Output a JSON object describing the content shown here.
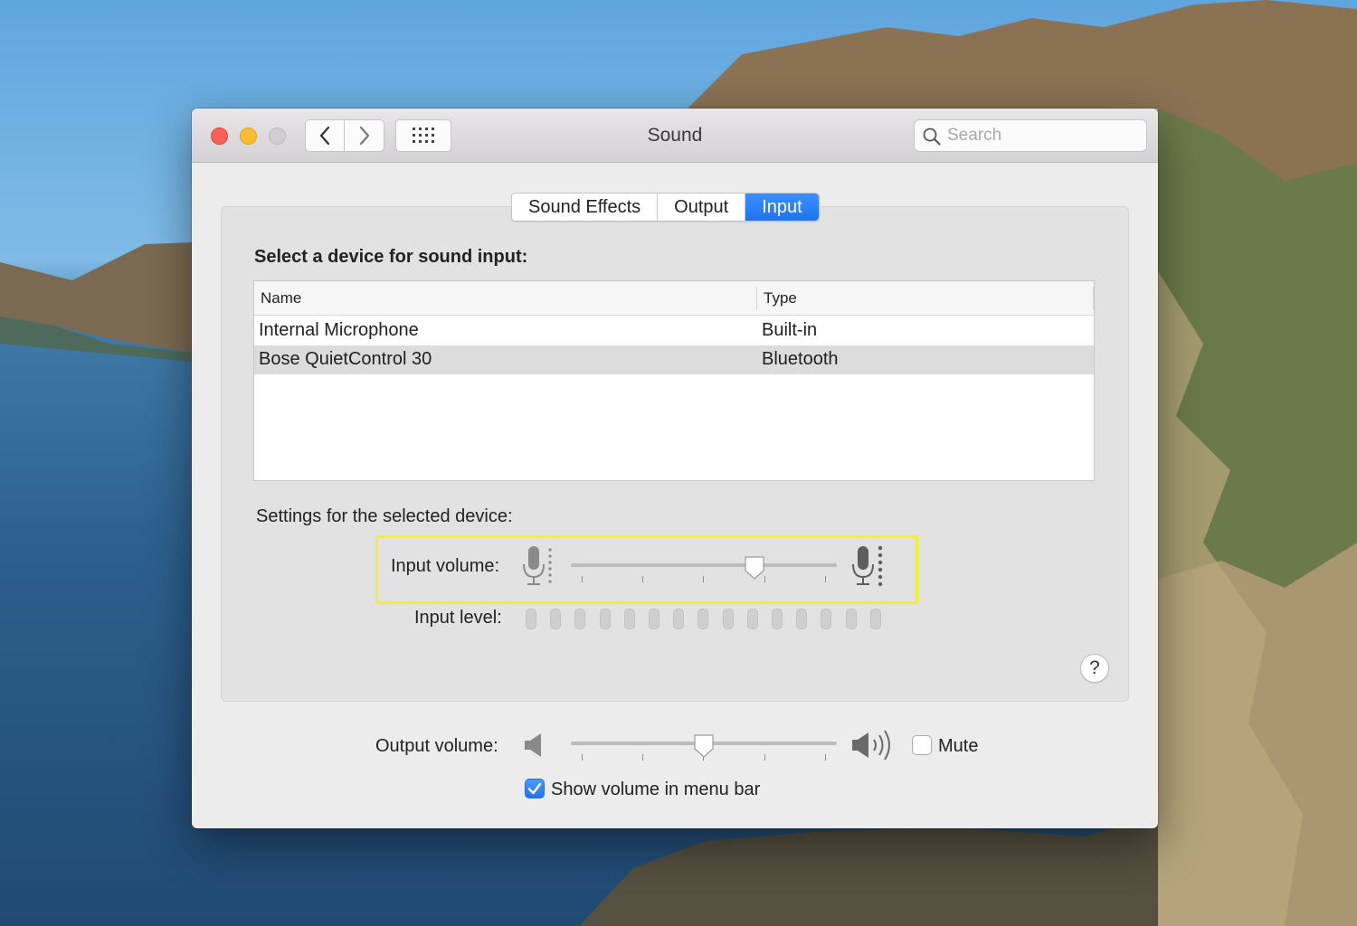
{
  "window": {
    "title": "Sound",
    "search_placeholder": "Search"
  },
  "tabs": [
    {
      "label": "Sound Effects",
      "active": false
    },
    {
      "label": "Output",
      "active": false
    },
    {
      "label": "Input",
      "active": true
    }
  ],
  "input": {
    "heading": "Select a device for sound input:",
    "columns": [
      "Name",
      "Type"
    ],
    "devices": [
      {
        "name": "Internal Microphone",
        "type": "Built-in",
        "selected": false
      },
      {
        "name": "Bose QuietControl 30",
        "type": "Bluetooth",
        "selected": true
      }
    ],
    "settings_label": "Settings for the selected device:",
    "input_volume_label": "Input volume:",
    "input_volume_fraction": 0.69,
    "input_level_label": "Input level:",
    "input_level_segments": 15,
    "input_level_lit": 0
  },
  "help_label": "?",
  "output": {
    "volume_label": "Output volume:",
    "volume_fraction": 0.5,
    "mute_label": "Mute",
    "mute_checked": false,
    "show_in_menu_label": "Show volume in menu bar",
    "show_in_menu_checked": true
  },
  "colors": {
    "accent": "#1f73f1",
    "highlight": "#f3ee36",
    "close": "#fe5f57",
    "minimize": "#febc2e"
  },
  "icons": [
    "close-icon",
    "minimize-icon",
    "zoom-icon",
    "chevron-left-icon",
    "chevron-right-icon",
    "grid-icon",
    "search-icon",
    "microphone-low-icon",
    "microphone-high-icon",
    "speaker-low-icon",
    "speaker-high-icon",
    "checkmark-icon"
  ]
}
